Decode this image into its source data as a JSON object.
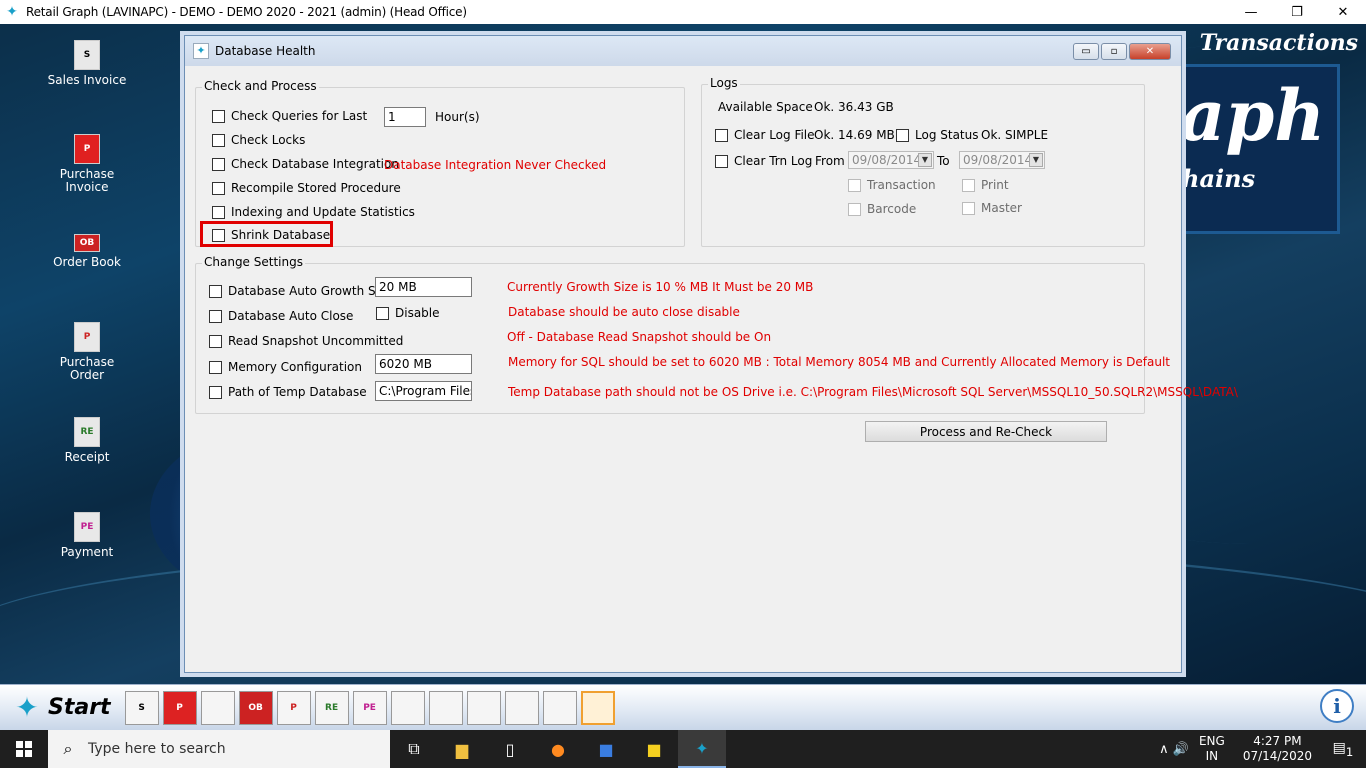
{
  "app": {
    "title": "Retail Graph (LAVINAPC) - DEMO - DEMO  2020 - 2021 (admin) (Head Office)",
    "icon": "retail-graph-logo",
    "controls": {
      "minimize": "—",
      "maximize": "❐",
      "close": "✕"
    }
  },
  "desktop": {
    "header": "Transactions",
    "logo_text": "aph",
    "logo_sub": "hains",
    "icons": [
      {
        "label": "Sales Invoice",
        "glyph": "S"
      },
      {
        "label": "Purchase Invoice",
        "glyph": "P"
      },
      {
        "label": "Order Book",
        "glyph": "OB"
      },
      {
        "label": "Purchase Order",
        "glyph": "P"
      },
      {
        "label": "Receipt",
        "glyph": "RE"
      },
      {
        "label": "Payment",
        "glyph": "PE"
      }
    ]
  },
  "dialog": {
    "title": "Database Health",
    "buttons": {
      "minimize": "▭",
      "maximize": "▫",
      "close": "✕"
    },
    "check_process": {
      "legend": "Check and Process",
      "check_queries": {
        "label": "Check Queries for Last",
        "value": "1",
        "unit": "Hour(s)"
      },
      "check_locks": {
        "label": "Check Locks"
      },
      "check_integration": {
        "label": "Check Database Integration",
        "status": "Database Integration Never Checked"
      },
      "recompile": {
        "label": "Recompile Stored Procedure"
      },
      "indexing": {
        "label": "Indexing and Update Statistics"
      },
      "shrink": {
        "label": "Shrink Database"
      }
    },
    "logs": {
      "legend": "Logs",
      "available_space_label": "Available Space",
      "available_space_value": "Ok. 36.43 GB",
      "clear_log_file": {
        "label": "Clear Log File",
        "value": "Ok. 14.69 MB"
      },
      "log_status": {
        "label": "Log Status",
        "value": "Ok. SIMPLE"
      },
      "clear_trn_log": {
        "label": "Clear Trn Log"
      },
      "from_label": "From",
      "from_date": "09/08/2014",
      "to_label": "To",
      "to_date": "09/08/2014",
      "transaction": "Transaction",
      "print": "Print",
      "barcode": "Barcode",
      "master": "Master"
    },
    "change_settings": {
      "legend": "Change Settings",
      "auto_growth": {
        "label": "Database Auto Growth Size",
        "value": "20 MB",
        "status": "Currently Growth Size is 10 % MB It Must be 20 MB"
      },
      "auto_close": {
        "label": "Database Auto Close",
        "disable_label": "Disable",
        "status": "Database should be auto close disable"
      },
      "read_snapshot": {
        "label": "Read Snapshot Uncommitted",
        "status": "Off - Database Read Snapshot should be On"
      },
      "memory": {
        "label": "Memory Configuration",
        "value": "6020 MB",
        "status": "Memory for SQL should be set to 6020 MB : Total Memory 8054 MB and Currently Allocated Memory is Default"
      },
      "temp_path": {
        "label": "Path of Temp Database",
        "value": "C:\\Program Files\\M",
        "status": "Temp Database path should not be OS Drive i.e. C:\\Program Files\\Microsoft SQL Server\\MSSQL10_50.SQLR2\\MSSQL\\DATA\\"
      }
    },
    "process_button": "Process and Re-Check"
  },
  "app_toolbar": {
    "start_label": "Start",
    "tools": [
      "S",
      "P",
      "",
      "OB",
      "P",
      "RE",
      "PE",
      "",
      "",
      "",
      "",
      "",
      ""
    ],
    "info": "i"
  },
  "taskbar": {
    "search_placeholder": "Type here to search",
    "apps": [
      "task-view-icon",
      "file-explorer-icon",
      "notepad-icon",
      "firefox-icon",
      "wps-icon",
      "sticky-notes-icon",
      "retail-graph-icon"
    ],
    "tray_symbols": "∧ 🔊",
    "lang_line1": "ENG",
    "lang_line2": "IN",
    "time": "4:27 PM",
    "date": "07/14/2020",
    "notifications": "1"
  },
  "colors": {
    "error_text": "#e00000",
    "highlight_border": "#e00000",
    "desktop_bg": "#0e4368"
  }
}
